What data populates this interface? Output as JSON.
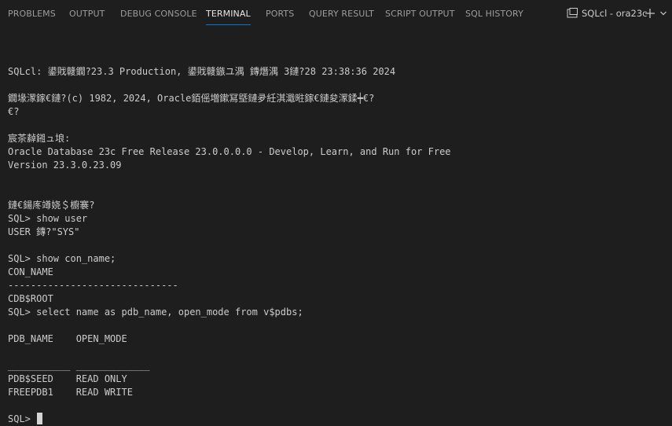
{
  "tabs": [
    {
      "label": "PROBLEMS"
    },
    {
      "label": "OUTPUT"
    },
    {
      "label": "DEBUG CONSOLE"
    },
    {
      "label": "TERMINAL",
      "active": true
    },
    {
      "label": "PORTS"
    },
    {
      "label": "QUERY RESULT"
    },
    {
      "label": "SCRIPT OUTPUT"
    },
    {
      "label": "SQL HISTORY"
    }
  ],
  "terminal_selector": {
    "name": "SQLcl - ora23c",
    "icon": "terminal-icon",
    "new_icon": "plus-icon",
    "dropdown_icon": "chevron-down-icon"
  },
  "colors": {
    "background": "#1e1e1e",
    "text": "#cccccc",
    "active_tab_underline": "#0078d4"
  },
  "terminal": {
    "lines": [
      "",
      "SQLcl: 鍙戝竷鐗?23.3 Production, 鍙戝竷鏃ユ湡 鏄熸湡 3鏈?28 23:38:36 2024",
      "",
      "鐗堟潈鎵€鏈?(c) 1982, 2024, Oracle銆傜増鏉冩墍鏈夛紝淇濈暀鎵€鏈夋潈鍒┿€?",
      "€?",
      "",
      "宸茶繛鎺ュ埌:",
      "Oracle Database 23c Free Release 23.0.0.0.0 - Develop, Learn, and Run for Free",
      "Version 23.3.0.23.09",
      "",
      "",
      "鏈€鍚庝竴娆＄櫥褰?",
      "SQL> show user",
      "USER 鏄?\"SYS\"",
      "",
      "SQL> show con_name;",
      "CON_NAME",
      "------------------------------",
      "CDB$ROOT",
      "SQL> select name as pdb_name, open_mode from v$pdbs;",
      "",
      "PDB_NAME    OPEN_MODE",
      "",
      "___________ _____________",
      "PDB$SEED    READ ONLY",
      "FREEPDB1    READ WRITE",
      "",
      "SQL> "
    ]
  }
}
